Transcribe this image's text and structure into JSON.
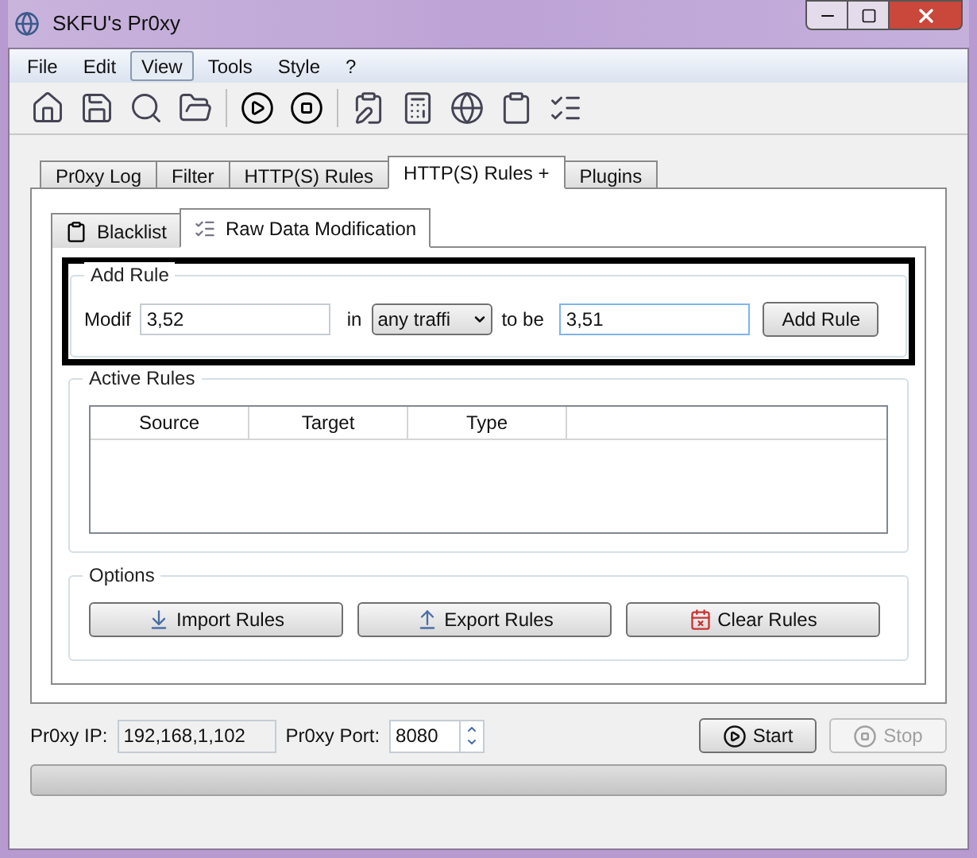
{
  "window": {
    "title": "SKFU's Pr0xy"
  },
  "menu": [
    {
      "label": "File",
      "selected": false
    },
    {
      "label": "Edit",
      "selected": false
    },
    {
      "label": "View",
      "selected": true
    },
    {
      "label": "Tools",
      "selected": false
    },
    {
      "label": "Style",
      "selected": false
    },
    {
      "label": "?",
      "selected": false
    }
  ],
  "tabs": [
    {
      "label": "Pr0xy Log",
      "selected": false
    },
    {
      "label": "Filter",
      "selected": false
    },
    {
      "label": "HTTP(S) Rules",
      "selected": false
    },
    {
      "label": "HTTP(S) Rules +",
      "selected": true
    },
    {
      "label": "Plugins",
      "selected": false
    }
  ],
  "subtabs": [
    {
      "label": "Blacklist",
      "selected": false
    },
    {
      "label": "Raw Data Modification",
      "selected": true
    }
  ],
  "add_rule": {
    "title": "Add Rule",
    "modify_label": "Modif",
    "modify_value": "3,52",
    "in_label": "in",
    "traffic_dropdown": "any traffi",
    "to_be_label": "to be",
    "to_be_value": "3,51",
    "button": "Add Rule"
  },
  "active_rules": {
    "title": "Active Rules",
    "columns": [
      "Source",
      "Target",
      "Type"
    ]
  },
  "options": {
    "title": "Options",
    "buttons": [
      "Import Rules",
      "Export Rules",
      "Clear Rules"
    ]
  },
  "progress": {
    "level": 0
  },
  "bottom": {
    "ip_label": "Pr0xy IP:",
    "ip_value": "192,168,1,102",
    "port_label": "Pr0xy Port:",
    "port_value": "8080",
    "buttons": [
      {
        "label": "Start",
        "disabled": false
      },
      {
        "label": "Stop",
        "disabled": true
      }
    ]
  }
}
